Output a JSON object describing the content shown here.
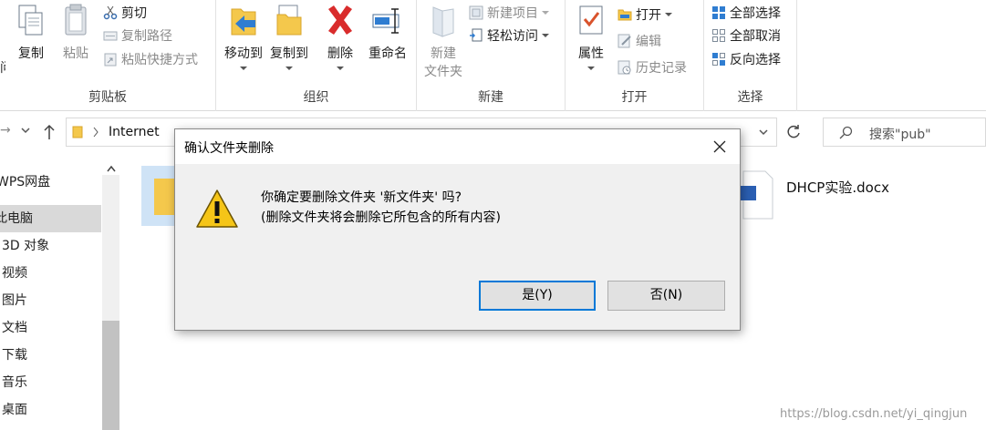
{
  "ribbon": {
    "clipboard": {
      "group_label": "剪贴板",
      "copy": "复制",
      "paste": "粘贴",
      "cut": "剪切",
      "copy_path": "复制路径",
      "paste_shortcut": "粘贴快捷方式",
      "partial_left": "问"
    },
    "organize": {
      "group_label": "组织",
      "move_to": "移动到",
      "copy_to": "复制到",
      "delete": "删除",
      "rename": "重命名"
    },
    "new": {
      "group_label": "新建",
      "new_folder_line1": "新建",
      "new_folder_line2": "文件夹",
      "new_item": "新建项目",
      "easy_access": "轻松访问"
    },
    "open": {
      "group_label": "打开",
      "properties": "属性",
      "open": "打开",
      "edit": "编辑",
      "history": "历史记录"
    },
    "select": {
      "group_label": "选择",
      "select_all": "全部选择",
      "select_none": "全部取消",
      "invert": "反向选择"
    }
  },
  "navbar": {
    "breadcrumb_internet": "Internet",
    "search_placeholder": "搜索\"pub\""
  },
  "sidebar": {
    "items": [
      {
        "label": "WPS网盘"
      },
      {
        "label": "此电脑"
      },
      {
        "label": "3D 对象"
      },
      {
        "label": "视频"
      },
      {
        "label": "图片"
      },
      {
        "label": "文档"
      },
      {
        "label": "下载"
      },
      {
        "label": "音乐"
      },
      {
        "label": "桌面"
      }
    ]
  },
  "content": {
    "file_name": "DHCP实验.docx"
  },
  "dialog": {
    "title": "确认文件夹删除",
    "message_line1": "你确定要删除文件夹 '新文件夹' 吗?",
    "message_line2": "(删除文件夹将会删除它所包含的所有内容)",
    "yes": "是(Y)",
    "no": "否(N)"
  },
  "watermark": "https://blog.csdn.net/yi_qingjun"
}
